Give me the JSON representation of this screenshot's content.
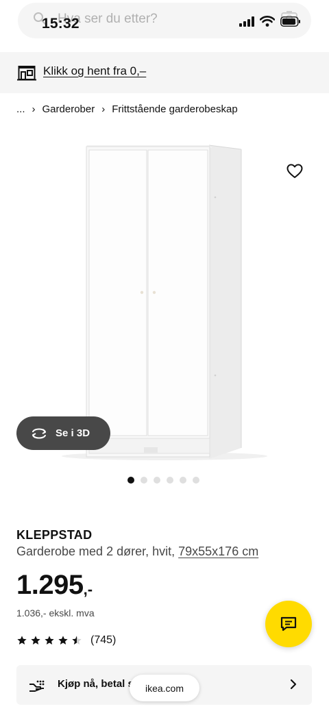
{
  "status_bar": {
    "time": "15:32"
  },
  "search": {
    "placeholder": "Hva ser du etter?"
  },
  "collect": {
    "label": "Klikk og hent fra 0,–"
  },
  "breadcrumb": {
    "items": [
      "...",
      "Garderober",
      "Frittstående garderobeskap"
    ]
  },
  "gallery": {
    "see_3d_label": "Se i 3D",
    "image_count": 6,
    "active_index": 0
  },
  "product": {
    "name": "KLEPPSTAD",
    "description": "Garderobe med 2 dører, hvit,",
    "dimensions": "79x55x176 cm",
    "price_main": "1.295",
    "price_suffix": ",-",
    "price_ex_vat": "1.036,- ekskl. mva",
    "rating_value": 4.5,
    "rating_max": 5,
    "rating_count": "(745)"
  },
  "buy_bar": {
    "label": "Kjøp nå, betal s"
  },
  "browser": {
    "url": "ikea.com"
  },
  "colors": {
    "accent_yellow": "#ffdb00",
    "dark_pill": "#484848",
    "light_bg": "#f5f5f5"
  },
  "icons": {
    "search": "search-icon",
    "collect": "store-pickup-icon",
    "favourite": "heart-icon",
    "see_3d": "rotate-3d-icon",
    "chat": "chat-icon",
    "buy": "payment-icon",
    "chevron": "chevron-right-icon"
  }
}
